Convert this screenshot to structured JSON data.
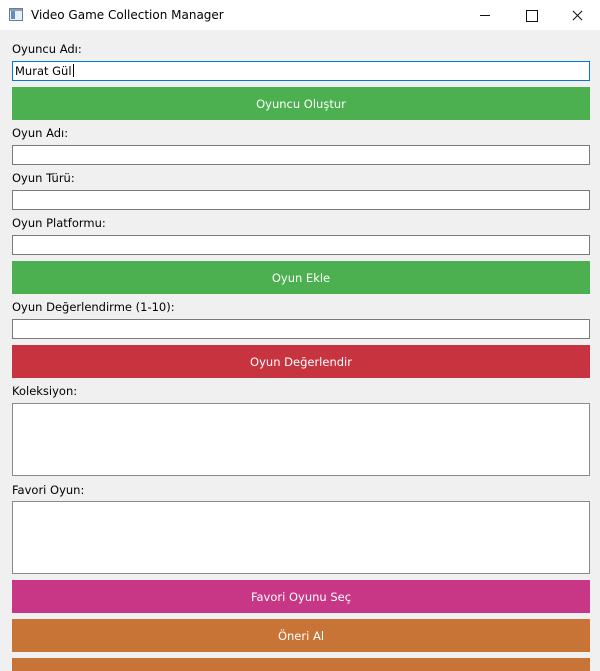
{
  "window": {
    "title": "Video Game Collection Manager"
  },
  "form": {
    "player_name_label": "Oyuncu Adı:",
    "player_name_value": "Murat Gül",
    "create_player_button": "Oyuncu Oluştur",
    "game_name_label": "Oyun Adı:",
    "game_name_value": "",
    "game_genre_label": "Oyun Türü:",
    "game_genre_value": "",
    "game_platform_label": "Oyun Platformu:",
    "game_platform_value": "",
    "add_game_button": "Oyun Ekle",
    "rating_label": "Oyun Değerlendirme (1-10):",
    "rating_value": "",
    "rate_game_button": "Oyun Değerlendir",
    "collection_label": "Koleksiyon:",
    "favorite_label": "Favori Oyun:",
    "select_favorite_button": "Favori Oyunu Seç",
    "get_recommendation_button": "Öneri Al"
  },
  "colors": {
    "green_button": "#4caf50",
    "red_button": "#c73440",
    "pink_button": "#c73785",
    "orange_button": "#c87437",
    "focus_border": "#0078d7"
  },
  "icons": {
    "app": "window-app-icon",
    "minimize": "minimize-icon",
    "maximize": "maximize-icon",
    "close": "close-icon"
  }
}
